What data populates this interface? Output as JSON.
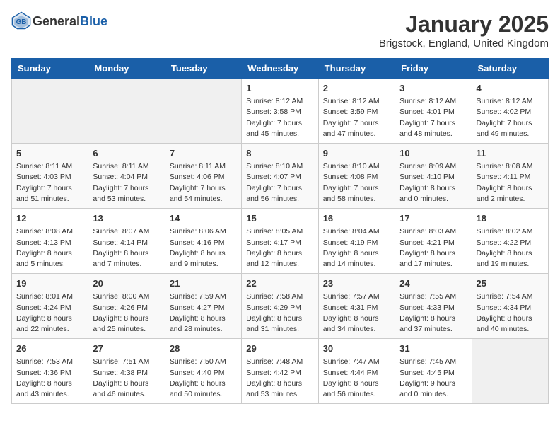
{
  "header": {
    "logo_general": "General",
    "logo_blue": "Blue",
    "month": "January 2025",
    "location": "Brigstock, England, United Kingdom"
  },
  "days_of_week": [
    "Sunday",
    "Monday",
    "Tuesday",
    "Wednesday",
    "Thursday",
    "Friday",
    "Saturday"
  ],
  "weeks": [
    [
      {
        "day": "",
        "info": ""
      },
      {
        "day": "",
        "info": ""
      },
      {
        "day": "",
        "info": ""
      },
      {
        "day": "1",
        "info": "Sunrise: 8:12 AM\nSunset: 3:58 PM\nDaylight: 7 hours and 45 minutes."
      },
      {
        "day": "2",
        "info": "Sunrise: 8:12 AM\nSunset: 3:59 PM\nDaylight: 7 hours and 47 minutes."
      },
      {
        "day": "3",
        "info": "Sunrise: 8:12 AM\nSunset: 4:01 PM\nDaylight: 7 hours and 48 minutes."
      },
      {
        "day": "4",
        "info": "Sunrise: 8:12 AM\nSunset: 4:02 PM\nDaylight: 7 hours and 49 minutes."
      }
    ],
    [
      {
        "day": "5",
        "info": "Sunrise: 8:11 AM\nSunset: 4:03 PM\nDaylight: 7 hours and 51 minutes."
      },
      {
        "day": "6",
        "info": "Sunrise: 8:11 AM\nSunset: 4:04 PM\nDaylight: 7 hours and 53 minutes."
      },
      {
        "day": "7",
        "info": "Sunrise: 8:11 AM\nSunset: 4:06 PM\nDaylight: 7 hours and 54 minutes."
      },
      {
        "day": "8",
        "info": "Sunrise: 8:10 AM\nSunset: 4:07 PM\nDaylight: 7 hours and 56 minutes."
      },
      {
        "day": "9",
        "info": "Sunrise: 8:10 AM\nSunset: 4:08 PM\nDaylight: 7 hours and 58 minutes."
      },
      {
        "day": "10",
        "info": "Sunrise: 8:09 AM\nSunset: 4:10 PM\nDaylight: 8 hours and 0 minutes."
      },
      {
        "day": "11",
        "info": "Sunrise: 8:08 AM\nSunset: 4:11 PM\nDaylight: 8 hours and 2 minutes."
      }
    ],
    [
      {
        "day": "12",
        "info": "Sunrise: 8:08 AM\nSunset: 4:13 PM\nDaylight: 8 hours and 5 minutes."
      },
      {
        "day": "13",
        "info": "Sunrise: 8:07 AM\nSunset: 4:14 PM\nDaylight: 8 hours and 7 minutes."
      },
      {
        "day": "14",
        "info": "Sunrise: 8:06 AM\nSunset: 4:16 PM\nDaylight: 8 hours and 9 minutes."
      },
      {
        "day": "15",
        "info": "Sunrise: 8:05 AM\nSunset: 4:17 PM\nDaylight: 8 hours and 12 minutes."
      },
      {
        "day": "16",
        "info": "Sunrise: 8:04 AM\nSunset: 4:19 PM\nDaylight: 8 hours and 14 minutes."
      },
      {
        "day": "17",
        "info": "Sunrise: 8:03 AM\nSunset: 4:21 PM\nDaylight: 8 hours and 17 minutes."
      },
      {
        "day": "18",
        "info": "Sunrise: 8:02 AM\nSunset: 4:22 PM\nDaylight: 8 hours and 19 minutes."
      }
    ],
    [
      {
        "day": "19",
        "info": "Sunrise: 8:01 AM\nSunset: 4:24 PM\nDaylight: 8 hours and 22 minutes."
      },
      {
        "day": "20",
        "info": "Sunrise: 8:00 AM\nSunset: 4:26 PM\nDaylight: 8 hours and 25 minutes."
      },
      {
        "day": "21",
        "info": "Sunrise: 7:59 AM\nSunset: 4:27 PM\nDaylight: 8 hours and 28 minutes."
      },
      {
        "day": "22",
        "info": "Sunrise: 7:58 AM\nSunset: 4:29 PM\nDaylight: 8 hours and 31 minutes."
      },
      {
        "day": "23",
        "info": "Sunrise: 7:57 AM\nSunset: 4:31 PM\nDaylight: 8 hours and 34 minutes."
      },
      {
        "day": "24",
        "info": "Sunrise: 7:55 AM\nSunset: 4:33 PM\nDaylight: 8 hours and 37 minutes."
      },
      {
        "day": "25",
        "info": "Sunrise: 7:54 AM\nSunset: 4:34 PM\nDaylight: 8 hours and 40 minutes."
      }
    ],
    [
      {
        "day": "26",
        "info": "Sunrise: 7:53 AM\nSunset: 4:36 PM\nDaylight: 8 hours and 43 minutes."
      },
      {
        "day": "27",
        "info": "Sunrise: 7:51 AM\nSunset: 4:38 PM\nDaylight: 8 hours and 46 minutes."
      },
      {
        "day": "28",
        "info": "Sunrise: 7:50 AM\nSunset: 4:40 PM\nDaylight: 8 hours and 50 minutes."
      },
      {
        "day": "29",
        "info": "Sunrise: 7:48 AM\nSunset: 4:42 PM\nDaylight: 8 hours and 53 minutes."
      },
      {
        "day": "30",
        "info": "Sunrise: 7:47 AM\nSunset: 4:44 PM\nDaylight: 8 hours and 56 minutes."
      },
      {
        "day": "31",
        "info": "Sunrise: 7:45 AM\nSunset: 4:45 PM\nDaylight: 9 hours and 0 minutes."
      },
      {
        "day": "",
        "info": ""
      }
    ]
  ]
}
